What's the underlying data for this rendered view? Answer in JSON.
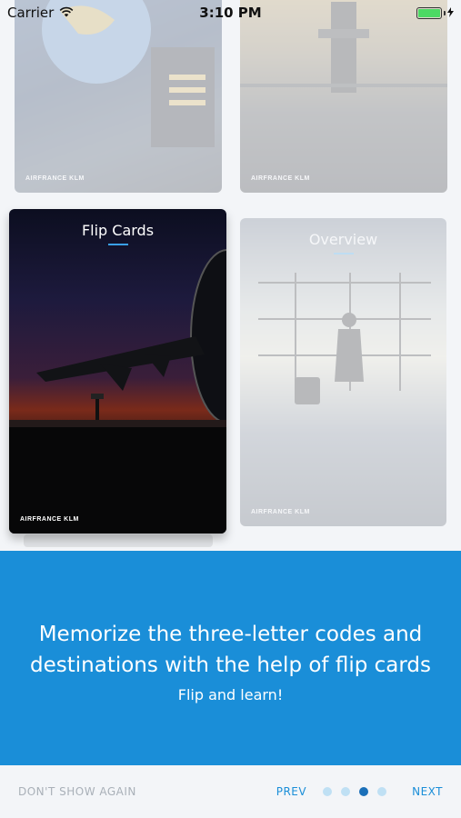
{
  "status_bar": {
    "carrier": "Carrier",
    "time": "3:10 PM"
  },
  "cards": {
    "top_left": {
      "logo": "AIRFRANCE KLM"
    },
    "top_right": {
      "logo": "AIRFRANCE KLM"
    },
    "flip": {
      "title": "Flip Cards",
      "logo": "AIRFRANCE KLM"
    },
    "overview": {
      "title": "Overview",
      "logo": "AIRFRANCE KLM"
    }
  },
  "info": {
    "heading": "Memorize the three-letter codes and destinations with the help of flip cards",
    "subtitle": "Flip and learn!"
  },
  "footer": {
    "dont_show": "DON'T SHOW AGAIN",
    "prev": "PREV",
    "next": "NEXT",
    "page_count": 4,
    "active_page": 3
  },
  "colors": {
    "accent": "#1a8ed8",
    "battery": "#4cd964",
    "dot_active": "#1a6fb8",
    "dot_inactive": "#bfe0f4"
  },
  "icons": {
    "wifi": "wifi-icon",
    "battery": "battery-icon",
    "charging": "charging-bolt-icon"
  }
}
